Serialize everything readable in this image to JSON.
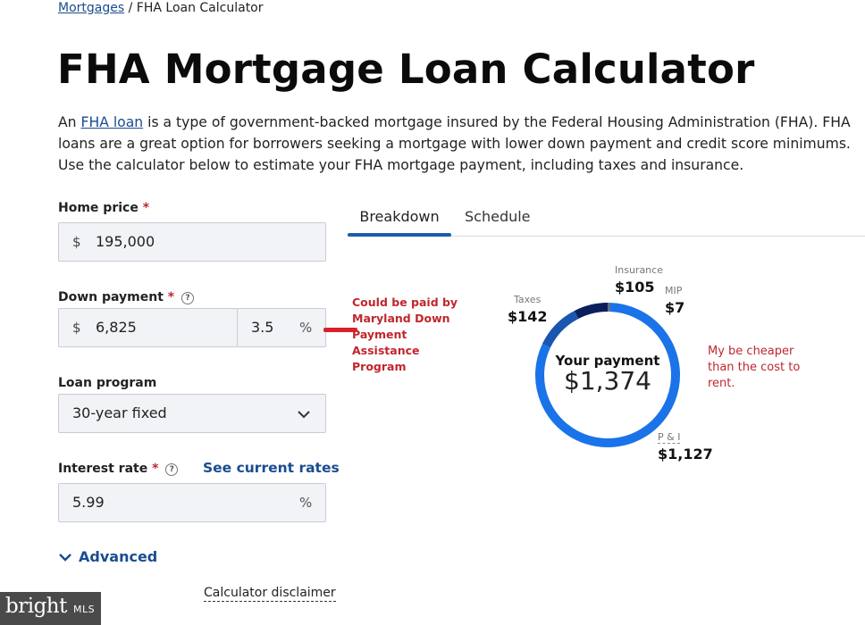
{
  "breadcrumb": {
    "link": "Mortgages",
    "separator": "/",
    "current": "FHA Loan Calculator"
  },
  "page_title": "FHA Mortgage Loan Calculator",
  "intro": {
    "before": "An ",
    "link": "FHA loan",
    "after": " is a type of government-backed mortgage insured by the Federal Housing Administration (FHA). FHA loans are a great option for borrowers seeking a mortgage with lower down payment and credit score minimums. Use the calculator below to estimate your FHA mortgage payment, including taxes and insurance."
  },
  "form": {
    "home_price": {
      "label": "Home price",
      "required_mark": "*",
      "prefix": "$",
      "value": "195,000"
    },
    "down_payment": {
      "label": "Down payment",
      "required_mark": "*",
      "help": "?",
      "prefix": "$",
      "value": "6,825",
      "percent": "3.5",
      "percent_suffix": "%"
    },
    "loan_program": {
      "label": "Loan program",
      "value": "30-year fixed"
    },
    "interest_rate": {
      "label": "Interest rate",
      "required_mark": "*",
      "help": "?",
      "rates_link": "See current rates",
      "value": "5.99",
      "suffix": "%"
    },
    "advanced": "Advanced",
    "disclaimer": "Calculator disclaimer"
  },
  "tabs": [
    {
      "label": "Breakdown",
      "active": true
    },
    {
      "label": "Schedule",
      "active": false
    }
  ],
  "donut": {
    "title": "Your payment",
    "amount": "$1,374",
    "segments": [
      {
        "label": "P & I",
        "value": "$1,127",
        "amount": 1127,
        "color": "#1a73e8"
      },
      {
        "label": "Taxes",
        "value": "$142",
        "amount": 142,
        "color": "#1a56b0"
      },
      {
        "label": "Insurance",
        "value": "$105",
        "amount": 105,
        "color": "#0b1f5c"
      },
      {
        "label": "MIP",
        "value": "$7",
        "amount": 7,
        "color": "#6e6e6e"
      }
    ]
  },
  "annotations": {
    "down_payment_note": "Could be paid by Maryland Down Payment Assistance Program",
    "cost_note": "My be cheaper than the cost to rent."
  },
  "watermark": {
    "brand": "bright",
    "suffix": "MLS"
  },
  "colors": {
    "link": "#1a4d8f",
    "annotation": "#c0262d",
    "tab_active": "#1b5ea8"
  }
}
